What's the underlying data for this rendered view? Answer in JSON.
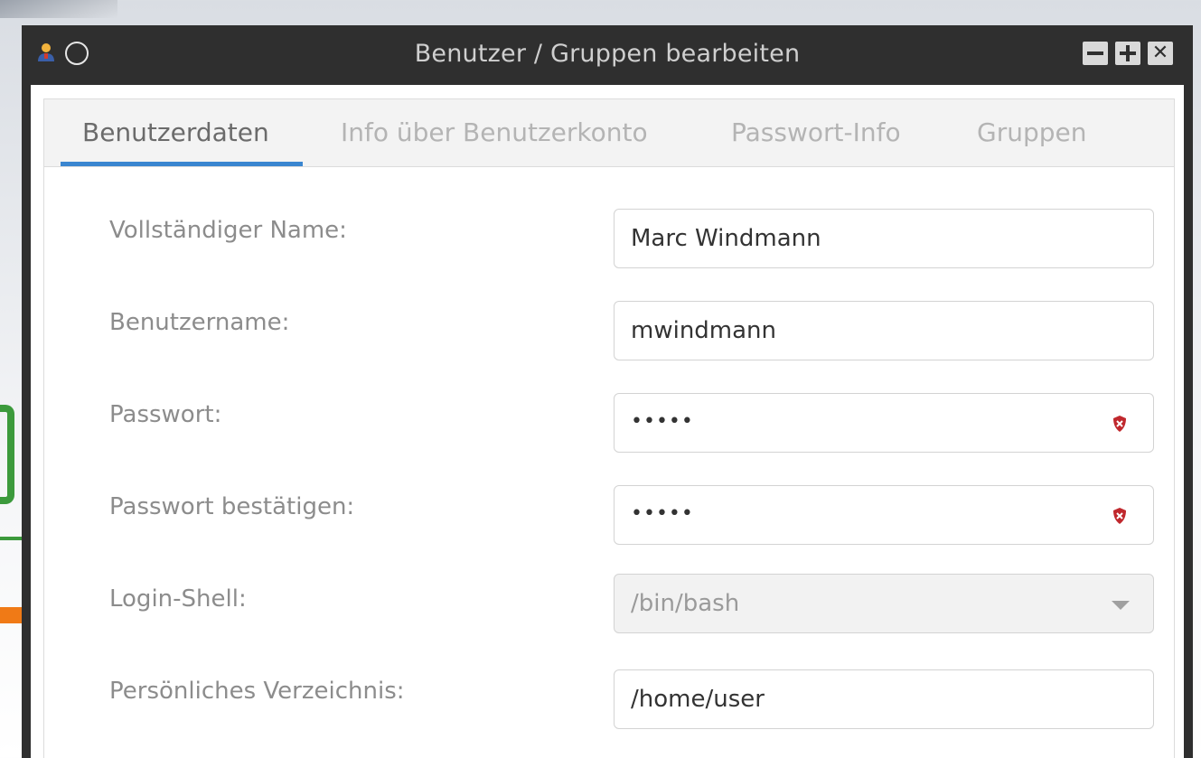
{
  "window": {
    "title": "Benutzer / Gruppen bearbeiten",
    "controls": {
      "minimize_icon": "minimize-icon",
      "maximize_icon": "maximize-icon",
      "close_label": "✕"
    }
  },
  "tabs": [
    {
      "label": "Benutzerdaten",
      "active": true
    },
    {
      "label": "Info über Benutzerkonto",
      "active": false
    },
    {
      "label": "Passwort-Info",
      "active": false
    },
    {
      "label": "Gruppen",
      "active": false
    }
  ],
  "form": {
    "full_name": {
      "label": "Vollständiger Name:",
      "value": "Marc Windmann"
    },
    "username": {
      "label": "Benutzername:",
      "value": "mwindmann"
    },
    "password": {
      "label": "Passwort:",
      "value": "•••••",
      "status_icon": "shield-warning-icon"
    },
    "password_confirm": {
      "label": "Passwort bestätigen:",
      "value": "•••••",
      "status_icon": "shield-warning-icon"
    },
    "login_shell": {
      "label": "Login-Shell:",
      "value": "/bin/bash",
      "enabled": false
    },
    "home_dir": {
      "label": "Persönliches Verzeichnis:",
      "value": "/home/user"
    }
  },
  "colors": {
    "titlebar": "#2f2f2f",
    "tab_accent": "#3a86d0",
    "warning": "#c0282d"
  }
}
